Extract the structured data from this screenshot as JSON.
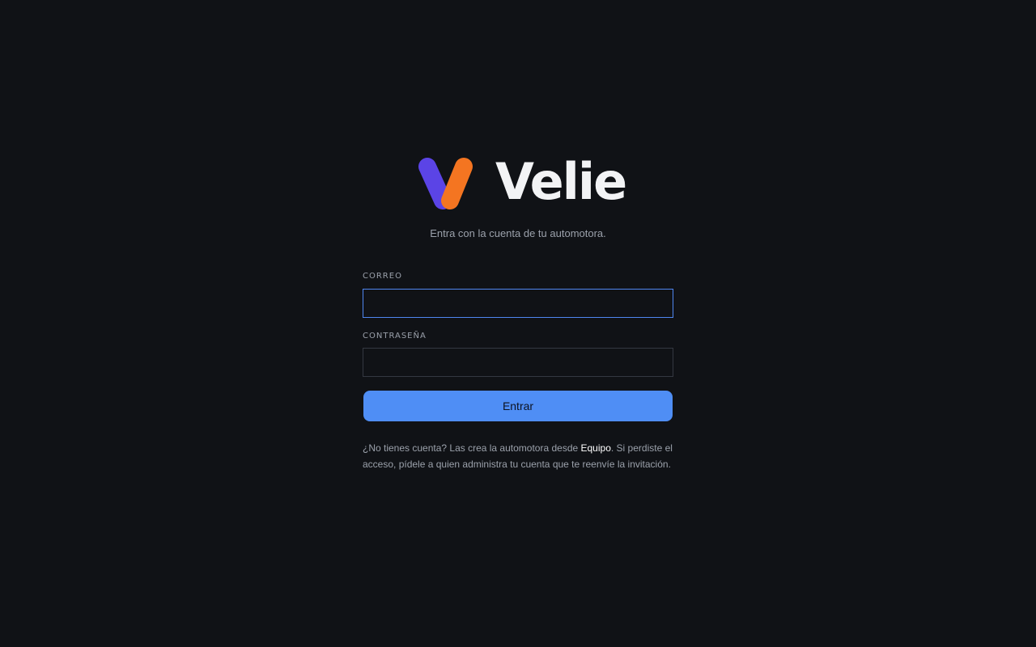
{
  "brand": {
    "name": "Velie",
    "colors": {
      "mark_left": "#5b44e6",
      "mark_right": "#f47521",
      "wordmark": "#f2f3f5"
    }
  },
  "subtitle": "Entra con la cuenta de tu automotora.",
  "form": {
    "email": {
      "label": "CORREO",
      "value": "",
      "placeholder": ""
    },
    "password": {
      "label": "CONTRASEÑA",
      "value": "",
      "placeholder": ""
    },
    "submit_label": "Entrar"
  },
  "help": {
    "before_link": "¿No tienes cuenta? Las crea la automotora desde ",
    "link_label": "Equipo",
    "after_link": ". Si perdiste el acceso, pídele a quien administra tu cuenta que te reenvíe la invitación."
  },
  "theme": {
    "background": "#101216",
    "accent": "#4f8ef5",
    "focus_border": "#4f86f0",
    "muted_text": "#9ba1ab"
  }
}
